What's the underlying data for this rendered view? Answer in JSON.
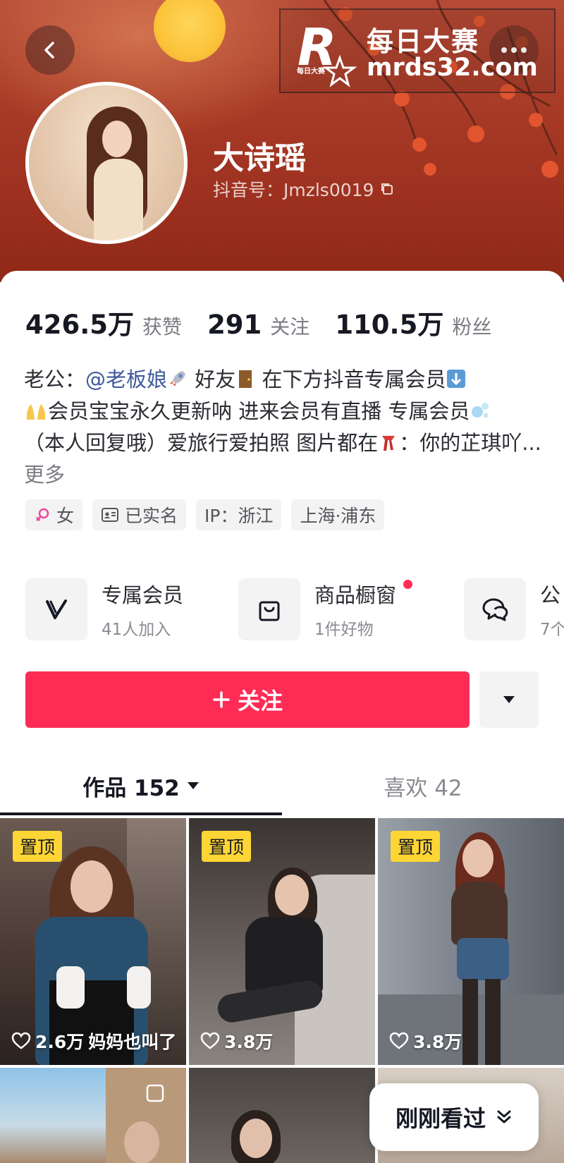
{
  "watermark": {
    "line1": "每日大赛",
    "line2": "mrds32.com",
    "logo_letter": "R",
    "logo_sub": "每日大赛"
  },
  "profile": {
    "name": "大诗瑶",
    "douyin_id": "抖音号：Jmzls0019"
  },
  "stats": [
    {
      "value": "426.5万",
      "label": "获赞"
    },
    {
      "value": "291",
      "label": "关注"
    },
    {
      "value": "110.5万",
      "label": "粉丝"
    }
  ],
  "bio": {
    "prefix": "老公：",
    "mention": "@老板娘",
    "text1": " 好友",
    "text2": " 在下方抖音专属会员",
    "text3": "会员宝宝永久更新呐 进来会员有直播  专属会员",
    "text4": "（本人回复哦）爱旅行爱拍照 图片都在",
    "text5": "：你的芷琪吖...",
    "more": "更多"
  },
  "tags": [
    {
      "icon": "female-icon",
      "label": "女"
    },
    {
      "icon": "id-card-icon",
      "label": "已实名"
    },
    {
      "icon": "",
      "label": "IP：浙江"
    },
    {
      "icon": "",
      "label": "上海·浦东"
    }
  ],
  "services": [
    {
      "icon": "vip-v-icon",
      "title": "专属会员",
      "subtitle": "41人加入"
    },
    {
      "icon": "shopping-bag-icon",
      "title": "商品橱窗",
      "subtitle": "1件好物",
      "has_dot": true
    },
    {
      "icon": "chat-bubble-icon",
      "title": "公",
      "subtitle": "7个"
    }
  ],
  "actions": {
    "follow_label": "关注",
    "follow_icon": "plus-icon",
    "dropdown_icon": "triangle-down-icon"
  },
  "tabs": [
    {
      "label": "作品 152",
      "active": true
    },
    {
      "label": "喜欢 42",
      "active": false
    }
  ],
  "videos": [
    {
      "pinned": true,
      "pin_label": "置顶",
      "likes": "2.6万",
      "caption": "妈妈也叫了"
    },
    {
      "pinned": true,
      "pin_label": "置顶",
      "likes": "3.8万",
      "caption": ""
    },
    {
      "pinned": true,
      "pin_label": "置顶",
      "likes": "3.8万",
      "caption": ""
    }
  ],
  "floating": {
    "recent_label": "刚刚看过"
  },
  "colors": {
    "accent": "#fe2c55",
    "pin_badge": "#fdd534",
    "mention": "#3e5a9b",
    "header": "#a73a26"
  }
}
